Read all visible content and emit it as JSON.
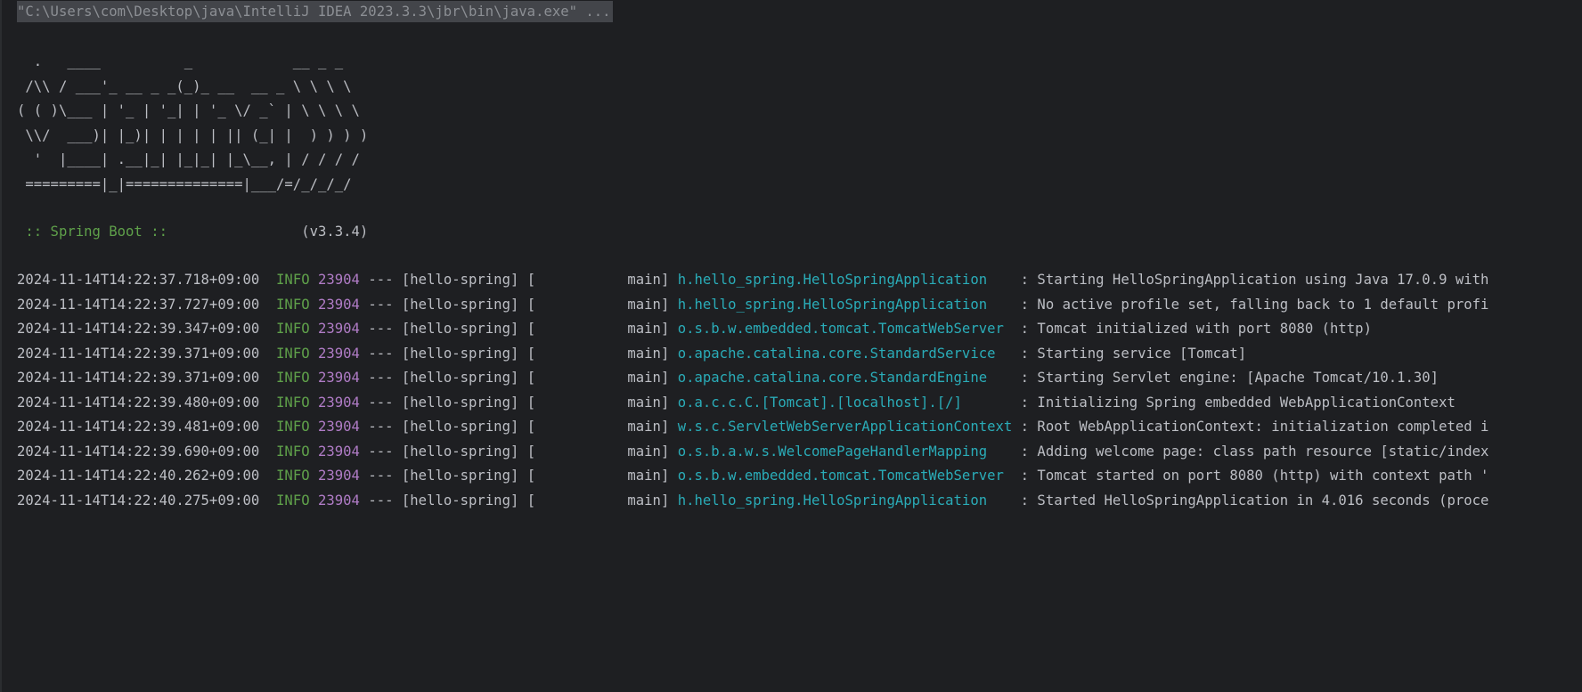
{
  "console": {
    "command": "\"C:\\Users\\com\\Desktop\\java\\IntelliJ IDEA 2023.3.3\\jbr\\bin\\java.exe\" ...",
    "banner": "  .   ____          _            __ _ _\n /\\\\ / ___'_ __ _ _(_)_ __  __ _ \\ \\ \\ \\\n( ( )\\___ | '_ | '_| | '_ \\/ _` | \\ \\ \\ \\\n \\\\/  ___)| |_)| | | | | || (_| |  ) ) ) )\n  '  |____| .__|_| |_|_| |_\\__, | / / / /\n =========|_|==============|___/=/_/_/_/",
    "spring_boot_label": " :: Spring Boot :: ",
    "spring_boot_version": "               (v3.3.4)",
    "logs": [
      {
        "timestamp": "2024-11-14T14:22:37.718+09:00",
        "level": "INFO",
        "pid": "23904",
        "separator": "---",
        "app": "[hello-spring]",
        "thread": "[           main]",
        "logger": "h.hello_spring.HelloSpringApplication   ",
        "message": ": Starting HelloSpringApplication using Java 17.0.9 with"
      },
      {
        "timestamp": "2024-11-14T14:22:37.727+09:00",
        "level": "INFO",
        "pid": "23904",
        "separator": "---",
        "app": "[hello-spring]",
        "thread": "[           main]",
        "logger": "h.hello_spring.HelloSpringApplication   ",
        "message": ": No active profile set, falling back to 1 default profi"
      },
      {
        "timestamp": "2024-11-14T14:22:39.347+09:00",
        "level": "INFO",
        "pid": "23904",
        "separator": "---",
        "app": "[hello-spring]",
        "thread": "[           main]",
        "logger": "o.s.b.w.embedded.tomcat.TomcatWebServer ",
        "message": ": Tomcat initialized with port 8080 (http)"
      },
      {
        "timestamp": "2024-11-14T14:22:39.371+09:00",
        "level": "INFO",
        "pid": "23904",
        "separator": "---",
        "app": "[hello-spring]",
        "thread": "[           main]",
        "logger": "o.apache.catalina.core.StandardService  ",
        "message": ": Starting service [Tomcat]"
      },
      {
        "timestamp": "2024-11-14T14:22:39.371+09:00",
        "level": "INFO",
        "pid": "23904",
        "separator": "---",
        "app": "[hello-spring]",
        "thread": "[           main]",
        "logger": "o.apache.catalina.core.StandardEngine   ",
        "message": ": Starting Servlet engine: [Apache Tomcat/10.1.30]"
      },
      {
        "timestamp": "2024-11-14T14:22:39.480+09:00",
        "level": "INFO",
        "pid": "23904",
        "separator": "---",
        "app": "[hello-spring]",
        "thread": "[           main]",
        "logger": "o.a.c.c.C.[Tomcat].[localhost].[/]      ",
        "message": ": Initializing Spring embedded WebApplicationContext"
      },
      {
        "timestamp": "2024-11-14T14:22:39.481+09:00",
        "level": "INFO",
        "pid": "23904",
        "separator": "---",
        "app": "[hello-spring]",
        "thread": "[           main]",
        "logger": "w.s.c.ServletWebServerApplicationContext",
        "message": ": Root WebApplicationContext: initialization completed i"
      },
      {
        "timestamp": "2024-11-14T14:22:39.690+09:00",
        "level": "INFO",
        "pid": "23904",
        "separator": "---",
        "app": "[hello-spring]",
        "thread": "[           main]",
        "logger": "o.s.b.a.w.s.WelcomePageHandlerMapping   ",
        "message": ": Adding welcome page: class path resource [static/index"
      },
      {
        "timestamp": "2024-11-14T14:22:40.262+09:00",
        "level": "INFO",
        "pid": "23904",
        "separator": "---",
        "app": "[hello-spring]",
        "thread": "[           main]",
        "logger": "o.s.b.w.embedded.tomcat.TomcatWebServer ",
        "message": ": Tomcat started on port 8080 (http) with context path '"
      },
      {
        "timestamp": "2024-11-14T14:22:40.275+09:00",
        "level": "INFO",
        "pid": "23904",
        "separator": "---",
        "app": "[hello-spring]",
        "thread": "[           main]",
        "logger": "h.hello_spring.HelloSpringApplication   ",
        "message": ": Started HelloSpringApplication in 4.016 seconds (proce"
      }
    ],
    "colors": {
      "background": "#1e1f22",
      "text": "#bcbec4",
      "level_info": "#5fa04a",
      "pid": "#b07cc6",
      "logger": "#2aacb8",
      "command_highlight": "#43454a"
    }
  }
}
